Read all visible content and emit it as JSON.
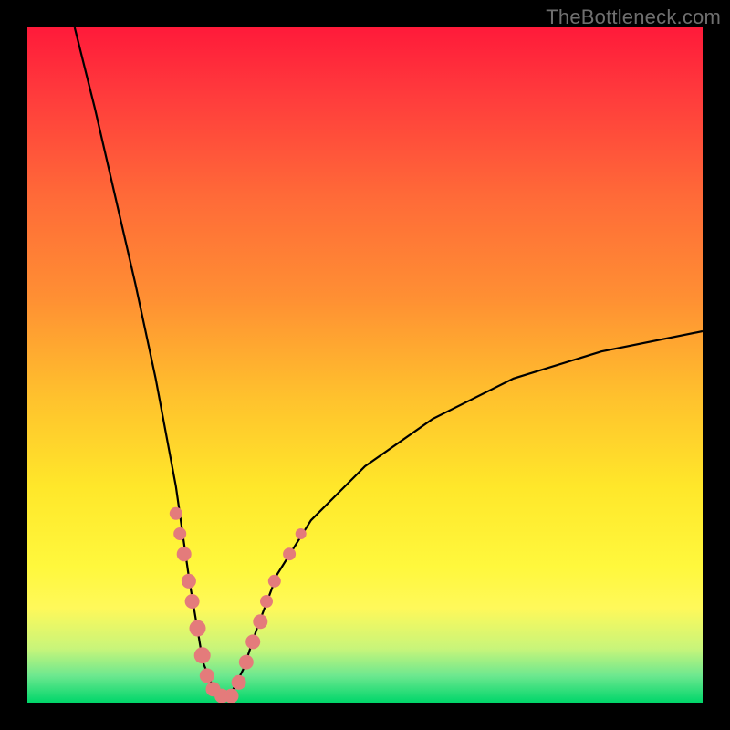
{
  "watermark": "TheBottleneck.com",
  "colors": {
    "dot": "#e47b7b",
    "curve": "#000000",
    "gradient_top": "#ff1a3a",
    "gradient_bottom": "#00d66a",
    "frame": "#000000"
  },
  "chart_data": {
    "type": "line",
    "title": "",
    "xlabel": "",
    "ylabel": "",
    "xlim": [
      0,
      100
    ],
    "ylim": [
      0,
      100
    ],
    "curve": {
      "description": "V-shaped bottleneck curve; y is bottleneck percentage, x is relative hardware balance. Minimum near x≈28 at y≈0. Left branch rises steeply to y=100 at x≈7; right branch rises toward y≈55 at x=100.",
      "points": [
        {
          "x": 7,
          "y": 100
        },
        {
          "x": 10,
          "y": 88
        },
        {
          "x": 13,
          "y": 75
        },
        {
          "x": 16,
          "y": 62
        },
        {
          "x": 19,
          "y": 48
        },
        {
          "x": 22,
          "y": 32
        },
        {
          "x": 24,
          "y": 18
        },
        {
          "x": 26,
          "y": 6
        },
        {
          "x": 28,
          "y": 1
        },
        {
          "x": 30,
          "y": 1
        },
        {
          "x": 32,
          "y": 5
        },
        {
          "x": 34,
          "y": 11
        },
        {
          "x": 37,
          "y": 19
        },
        {
          "x": 42,
          "y": 27
        },
        {
          "x": 50,
          "y": 35
        },
        {
          "x": 60,
          "y": 42
        },
        {
          "x": 72,
          "y": 48
        },
        {
          "x": 85,
          "y": 52
        },
        {
          "x": 100,
          "y": 55
        }
      ]
    },
    "highlight_dots": {
      "description": "Pink sample dots clustered near the trough on both branches, spanning roughly y=2 to y=28.",
      "points": [
        {
          "x": 22.0,
          "y": 28,
          "r": 7
        },
        {
          "x": 22.6,
          "y": 25,
          "r": 7
        },
        {
          "x": 23.2,
          "y": 22,
          "r": 8
        },
        {
          "x": 23.9,
          "y": 18,
          "r": 8
        },
        {
          "x": 24.4,
          "y": 15,
          "r": 8
        },
        {
          "x": 25.2,
          "y": 11,
          "r": 9
        },
        {
          "x": 25.9,
          "y": 7,
          "r": 9
        },
        {
          "x": 26.6,
          "y": 4,
          "r": 8
        },
        {
          "x": 27.5,
          "y": 2,
          "r": 8
        },
        {
          "x": 28.8,
          "y": 1,
          "r": 8
        },
        {
          "x": 30.2,
          "y": 1,
          "r": 8
        },
        {
          "x": 31.3,
          "y": 3,
          "r": 8
        },
        {
          "x": 32.4,
          "y": 6,
          "r": 8
        },
        {
          "x": 33.4,
          "y": 9,
          "r": 8
        },
        {
          "x": 34.5,
          "y": 12,
          "r": 8
        },
        {
          "x": 35.4,
          "y": 15,
          "r": 7
        },
        {
          "x": 36.6,
          "y": 18,
          "r": 7
        },
        {
          "x": 38.8,
          "y": 22,
          "r": 7
        },
        {
          "x": 40.5,
          "y": 25,
          "r": 6
        }
      ]
    }
  }
}
